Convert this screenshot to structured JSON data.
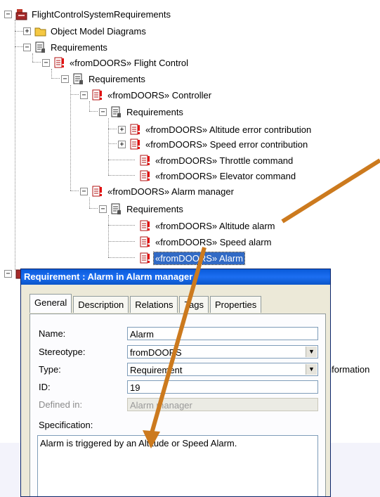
{
  "tree": {
    "root": "FlightControlSystemRequirements",
    "object_model_diagrams": "Object Model Diagrams",
    "requirements_1": "Requirements",
    "flight_control": "«fromDOORS» Flight Control",
    "requirements_2": "Requirements",
    "controller": "«fromDOORS» Controller",
    "requirements_3": "Requirements",
    "altitude_error": "«fromDOORS» Altitude error contribution",
    "speed_error": "«fromDOORS» Speed error contribution",
    "throttle": "«fromDOORS» Throttle command",
    "elevator": "«fromDOORS» Elevator command",
    "alarm_manager": "«fromDOORS» Alarm manager",
    "requirements_4": "Requirements",
    "altitude_alarm": "«fromDOORS» Altitude alarm",
    "speed_alarm": "«fromDOORS» Speed alarm",
    "alarm": "«fromDOORS» Alarm"
  },
  "dialog": {
    "title": "Requirement : Alarm in Alarm manager",
    "tabs": [
      "General",
      "Description",
      "Relations",
      "Tags",
      "Properties"
    ],
    "labels": {
      "name": "Name:",
      "stereotype": "Stereotype:",
      "type": "Type:",
      "id": "ID:",
      "defined_in": "Defined in:",
      "specification": "Specification:"
    },
    "values": {
      "name": "Alarm",
      "stereotype": "fromDOORS",
      "type": "Requirement",
      "id": "19",
      "defined_in": "Alarm manager",
      "specification": "Alarm is triggered by an Altitude or Speed Alarm."
    }
  },
  "outside_text": "information",
  "colors": {
    "arrow": "#cc7a1e",
    "selection": "#316ac5",
    "title_bar": "#0a5bd9"
  }
}
